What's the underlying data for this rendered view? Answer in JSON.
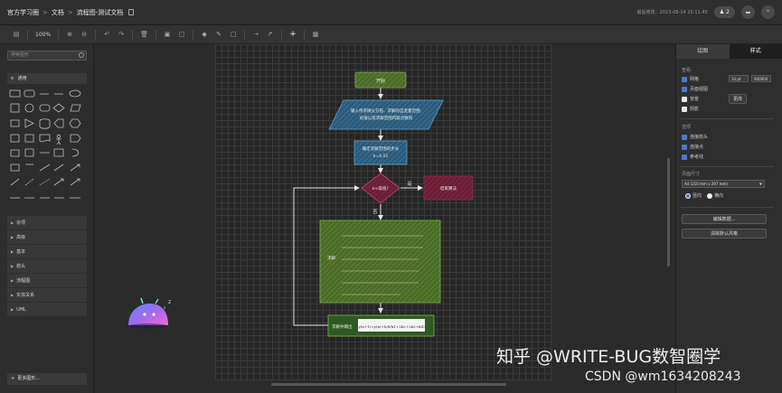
{
  "titlebar": {
    "crumb_1": "官方学习圈",
    "crumb_2": "文档",
    "crumb_3": "流程图-测试文档",
    "last_modified": "最后修改：2023-08-14 20:11:45",
    "collab_count": "2"
  },
  "toolbar": {
    "zoom": "100%"
  },
  "left_panel": {
    "search_placeholder": "搜索图形",
    "general_label": "通用",
    "categories": [
      "杂项",
      "高级",
      "基本",
      "箭头",
      "流程图",
      "实体关系",
      "UML"
    ],
    "more_shapes": "更多图形..."
  },
  "flowchart": {
    "start": "开始",
    "input_line1": "输入待求微分方程、求解的自变量范围,",
    "input_line2": "初值以及求解范围内取点数目",
    "step_line1": "确定求解范围的步长",
    "step_line2": "h=0.01",
    "decision": "k<取值?",
    "yes_label": "是",
    "no_label": "否",
    "end": "结束算法",
    "solve": "求解:",
    "output": "求解并输出",
    "output_formula": "y(n+1)=y(n)+h/6(k1+2k2+2k3+k4)"
  },
  "right_panel": {
    "tab_diagram": "绘图",
    "tab_style": "样式",
    "section_view": "查看",
    "grid_label": "网格",
    "grid_size": "10 pt",
    "grid_color": "000000",
    "page_view": "页面视图",
    "background": "背景",
    "edit_button": "更改",
    "shadow": "阴影",
    "section_options": "选项",
    "connection_arrows": "连接箭头",
    "connection_points": "连接点",
    "guides": "参考线",
    "section_paper": "页面尺寸",
    "paper_size": "A4 (210 mm x 297 mm)",
    "portrait": "竖向",
    "landscape": "横向",
    "edit_data_btn": "编辑数据...",
    "clear_default_btn": "清除默认风格"
  },
  "watermark": {
    "zhihu": "知乎 @WRITE-BUG数智圈学",
    "csdn": "CSDN @wm1634208243"
  }
}
